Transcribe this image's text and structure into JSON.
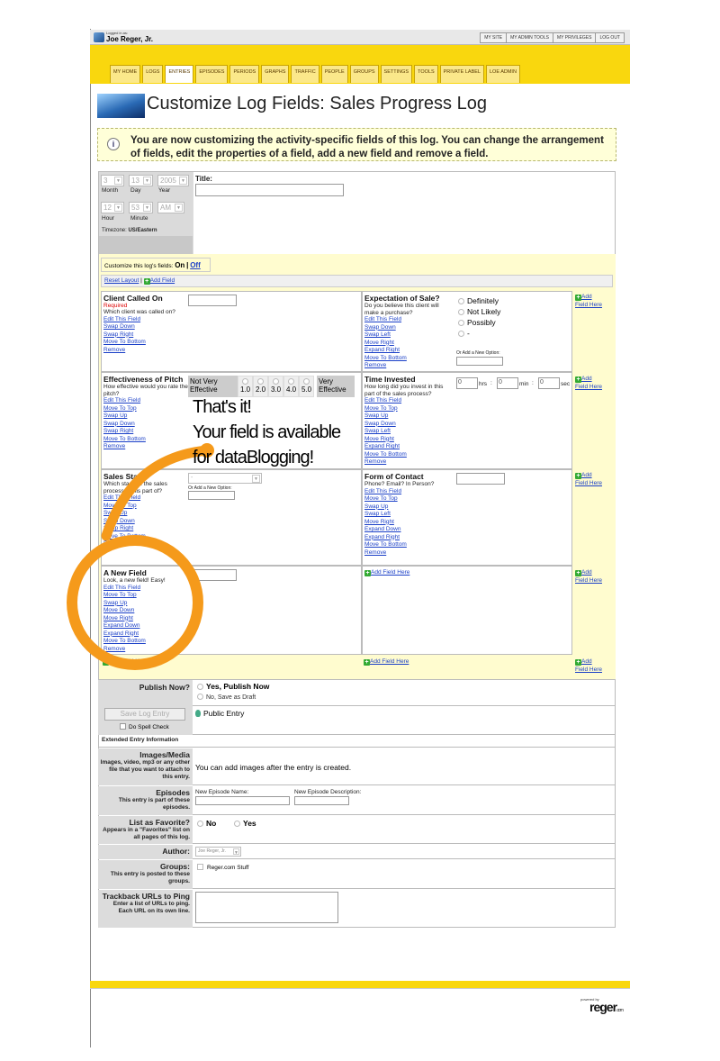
{
  "header": {
    "logged_in_label": "Logged in as:",
    "user_name": "Joe Reger, Jr.",
    "top_links": [
      "MY SITE",
      "MY ADMIN TOOLS",
      "MY PRIVILEGES",
      "LOG OUT"
    ]
  },
  "tabs": [
    "MY HOME",
    "LOGS",
    "ENTRIES",
    "EPISODES",
    "PERIODS",
    "GRAPHS",
    "TRAFFIC",
    "PEOPLE",
    "GROUPS",
    "SETTINGS",
    "TOOLS",
    "PRIVATE LABEL",
    "LOE ADMIN"
  ],
  "page_title": "Customize Log Fields: Sales Progress Log",
  "info_text": "You are now customizing the activity-specific fields of this log. You can change the arrangement of fields, edit the properties of a field, add a new field and remove a field.",
  "datetime": {
    "month": "3",
    "day": "13",
    "year": "2005",
    "hour": "12",
    "minute": "53",
    "ampm": "AM",
    "month_lbl": "Month",
    "day_lbl": "Day",
    "year_lbl": "Year",
    "hour_lbl": "Hour",
    "minute_lbl": "Minute",
    "timezone_lbl": "Timezone:",
    "timezone": "US/Eastern"
  },
  "title_label": "Title:",
  "customize": {
    "label": "Customize this log's fields:",
    "on": "On",
    "sep": "|",
    "off": "Off",
    "reset": "Reset Layout",
    "add_field": "Add Field"
  },
  "fields": {
    "client": {
      "name": "Client Called On",
      "req": "Required",
      "desc": "Which client was called on?",
      "links": [
        "Edit This Field",
        "Swap Down",
        "Swap Right",
        "Move To Bottom",
        "Remove"
      ]
    },
    "expectation": {
      "name": "Expectation of Sale?",
      "desc": "Do you believe this client will make a purchase?",
      "links": [
        "Edit This Field",
        "Swap Down",
        "Swap Left",
        "Move Right",
        "Expand Right",
        "Move To Bottom",
        "Remove"
      ],
      "options": [
        "Definitely",
        "Not Likely",
        "Possibly",
        "-"
      ],
      "add_option": "Or Add a New Option:"
    },
    "effectiveness": {
      "name": "Effectiveness of Pitch",
      "desc": "How effective would you rate the pitch?",
      "links": [
        "Edit This Field",
        "Move To Top",
        "Swap Up",
        "Swap Down",
        "Swap Right",
        "Move To Bottom",
        "Remove"
      ],
      "low": "Not Very Effective",
      "high": "Very Effective",
      "scale": [
        "1.0",
        "2.0",
        "3.0",
        "4.0",
        "5.0"
      ]
    },
    "time": {
      "name": "Time Invested",
      "desc": "How long did you invest in this part of the sales process?",
      "links": [
        "Edit This Field",
        "Move To Top",
        "Swap Up",
        "Swap Down",
        "Swap Left",
        "Move Right",
        "Expand Right",
        "Move To Bottom",
        "Remove"
      ],
      "hrs": "hrs",
      "min": "min",
      "sec": "sec",
      "h": "0",
      "m": "0",
      "s": "0",
      "colon": ":"
    },
    "stage": {
      "name": "Sales Stage",
      "desc": "Which stage of the sales process is this part of?",
      "links": [
        "Edit This Field",
        "Move To Top",
        "Swap Up",
        "Swap Down",
        "Swap Right",
        "Move To Bottom",
        "Remove"
      ],
      "select": "-",
      "add_option": "Or Add a New Option:"
    },
    "contact": {
      "name": "Form of Contact",
      "desc": "Phone? Email? In Person?",
      "links": [
        "Edit This Field",
        "Move To Top",
        "Swap Up",
        "Swap Left",
        "Move Right",
        "Expand Down",
        "Expand Right",
        "Move To Bottom",
        "Remove"
      ]
    },
    "newfield": {
      "name": "A New Field",
      "desc": "Look, a new field! Easy!",
      "links": [
        "Edit This Field",
        "Move To Top",
        "Swap Up",
        "Move Down",
        "Move Right",
        "Expand Down",
        "Expand Right",
        "Move To Bottom",
        "Remove"
      ]
    }
  },
  "add_field_here": "Add Field Here",
  "add_label": "Add",
  "field_here": "Field Here",
  "overlay": {
    "line1": "That's it!",
    "line2": "Your field is available",
    "line3": "for dataBlogging!"
  },
  "publish": {
    "label": "Publish Now?",
    "yes": "Yes, Publish Now",
    "no": "No, Save as Draft"
  },
  "save": {
    "button": "Save Log Entry",
    "spell": "Do Spell Check",
    "public": "Public Entry"
  },
  "extended": "Extended Entry Information",
  "images": {
    "label": "Images/Media",
    "desc": "Images, video, mp3 or any other file that you want to attach to this entry.",
    "text": "You can add images after the entry is created."
  },
  "episodes": {
    "label": "Episodes",
    "desc": "This entry is part of these episodes.",
    "name_lbl": "New Episode Name:",
    "desc_lbl": "New Episode Description:"
  },
  "favorite": {
    "label": "List as Favorite?",
    "desc": "Appears in a \"Favorites\" list on all pages of this log.",
    "no": "No",
    "yes": "Yes"
  },
  "author": {
    "label": "Author:",
    "value": "Joe Reger, Jr."
  },
  "groups": {
    "label": "Groups:",
    "desc": "This entry is posted to these groups.",
    "item": "Reger.com Stuff"
  },
  "trackback": {
    "label": "Trackback URLs to Ping",
    "desc": "Enter a list of URLs to ping. Each URL on its own line."
  },
  "footer": {
    "powered": "powered by",
    "brand": "reger",
    "com": ".com"
  },
  "colors": {
    "yellow": "#f9d70e",
    "orange": "#f59a1b",
    "link": "#1a3fc7",
    "grid_bg": "#fffccf"
  }
}
